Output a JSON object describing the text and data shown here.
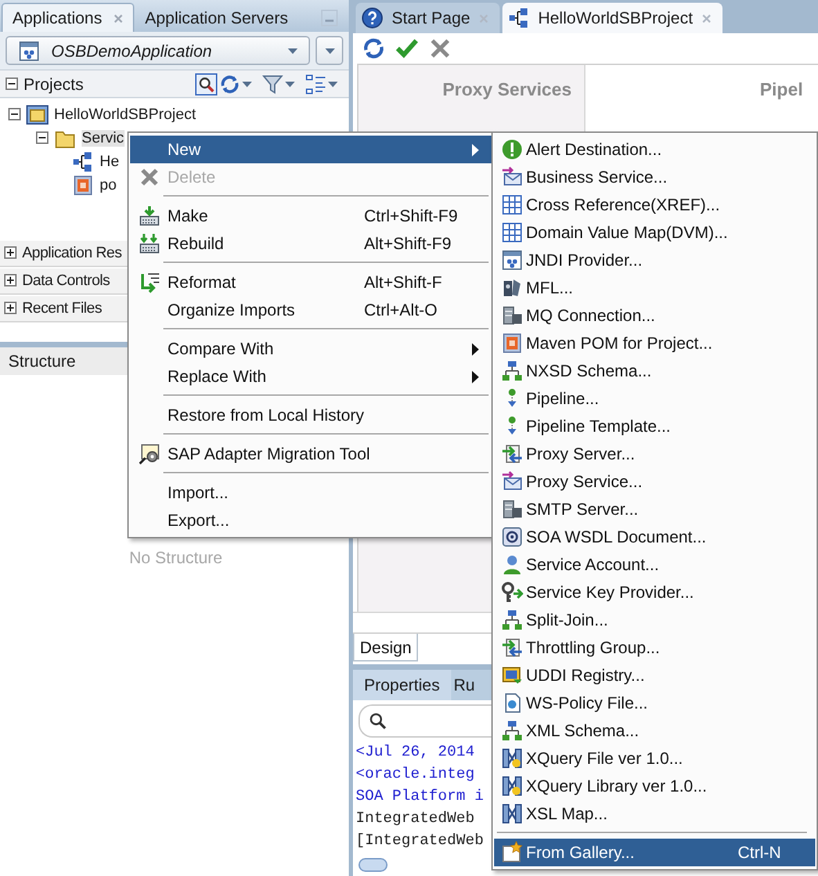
{
  "left_panel": {
    "tabs": [
      {
        "label": "Applications",
        "selected": true,
        "closable": true
      },
      {
        "label": "Application Servers",
        "selected": false,
        "closable": false
      }
    ],
    "application_selector": {
      "value": "OSBDemoApplication"
    },
    "projects_header": {
      "label": "Projects",
      "expanded": true
    },
    "project_tree": [
      {
        "label": "HelloWorldSBProject",
        "expanded": true,
        "selected": false,
        "children": [
          {
            "label": "Servic",
            "expanded": true,
            "selected": true,
            "children": [
              {
                "label": "He",
                "selected": false
              },
              {
                "label": "po",
                "selected": false
              }
            ]
          }
        ]
      }
    ],
    "accordion": [
      {
        "label": "Application Res",
        "expanded": false
      },
      {
        "label": "Data Controls",
        "expanded": false
      },
      {
        "label": "Recent Files",
        "expanded": false
      }
    ],
    "structure": {
      "title": "Structure",
      "empty_text": "No Structure"
    }
  },
  "editor": {
    "tabs": [
      {
        "label": "Start Page",
        "selected": false,
        "closable": true
      },
      {
        "label": "HelloWorldSBProject",
        "selected": true,
        "closable": true
      }
    ],
    "columns": [
      "Proxy Services",
      "Pipel"
    ],
    "view_tabs": [
      {
        "label": "Design",
        "selected": true
      }
    ]
  },
  "log_panel": {
    "tabs": [
      {
        "label": "Properties",
        "selected": true
      },
      {
        "label": "Ru",
        "selected": false
      }
    ],
    "lines": [
      {
        "text": "<Jul 26, 2014",
        "color": "#2020d0"
      },
      {
        "text": "<oracle.integ",
        "color": "#2020d0"
      },
      {
        "text": "SOA Platform i",
        "color": "#2020d0"
      },
      {
        "text": "IntegratedWeb",
        "color": "#202020"
      },
      {
        "text": "[IntegratedWeb",
        "color": "#202020"
      }
    ]
  },
  "context_menu": {
    "groups": [
      [
        {
          "label": "New",
          "selected": true,
          "disabled": false,
          "has_submenu": true
        },
        {
          "label": "Delete",
          "selected": false,
          "disabled": true,
          "has_submenu": false
        }
      ],
      [
        {
          "label": "Make",
          "shortcut": "Ctrl+Shift-F9",
          "selected": false,
          "disabled": false,
          "has_submenu": false
        },
        {
          "label": "Rebuild",
          "shortcut": "Alt+Shift-F9",
          "selected": false,
          "disabled": false,
          "has_submenu": false
        }
      ],
      [
        {
          "label": "Reformat",
          "shortcut": "Alt+Shift-F",
          "selected": false,
          "disabled": false,
          "has_submenu": false
        },
        {
          "label": "Organize Imports",
          "shortcut": "Ctrl+Alt-O",
          "selected": false,
          "disabled": false,
          "has_submenu": false
        }
      ],
      [
        {
          "label": "Compare With",
          "selected": false,
          "disabled": false,
          "has_submenu": true
        },
        {
          "label": "Replace With",
          "selected": false,
          "disabled": false,
          "has_submenu": true
        }
      ],
      [
        {
          "label": "Restore from Local History",
          "selected": false,
          "disabled": false,
          "has_submenu": false
        }
      ],
      [
        {
          "label": "SAP Adapter Migration Tool",
          "selected": false,
          "disabled": false,
          "has_submenu": false
        }
      ],
      [
        {
          "label": "Import...",
          "selected": false,
          "disabled": false,
          "has_submenu": false
        },
        {
          "label": "Export...",
          "selected": false,
          "disabled": false,
          "has_submenu": false
        }
      ]
    ]
  },
  "submenu": {
    "groups": [
      [
        {
          "label": "Alert Destination...",
          "selected": false,
          "disabled": false,
          "has_submenu": false
        },
        {
          "label": "Business Service...",
          "selected": false,
          "disabled": false,
          "has_submenu": false
        },
        {
          "label": "Cross Reference(XREF)...",
          "selected": false,
          "disabled": false,
          "has_submenu": false
        },
        {
          "label": "Domain Value Map(DVM)...",
          "selected": false,
          "disabled": false,
          "has_submenu": false
        },
        {
          "label": "JNDI Provider...",
          "selected": false,
          "disabled": false,
          "has_submenu": false
        },
        {
          "label": "MFL...",
          "selected": false,
          "disabled": false,
          "has_submenu": false
        },
        {
          "label": "MQ Connection...",
          "selected": false,
          "disabled": false,
          "has_submenu": false
        },
        {
          "label": "Maven POM for Project...",
          "selected": false,
          "disabled": false,
          "has_submenu": false
        },
        {
          "label": "NXSD Schema...",
          "selected": false,
          "disabled": false,
          "has_submenu": false
        },
        {
          "label": "Pipeline...",
          "selected": false,
          "disabled": false,
          "has_submenu": false
        },
        {
          "label": "Pipeline Template...",
          "selected": false,
          "disabled": false,
          "has_submenu": false
        },
        {
          "label": "Proxy Server...",
          "selected": false,
          "disabled": false,
          "has_submenu": false
        },
        {
          "label": "Proxy Service...",
          "selected": false,
          "disabled": false,
          "has_submenu": false
        },
        {
          "label": "SMTP Server...",
          "selected": false,
          "disabled": false,
          "has_submenu": false
        },
        {
          "label": "SOA WSDL Document...",
          "selected": false,
          "disabled": false,
          "has_submenu": false
        },
        {
          "label": "Service Account...",
          "selected": false,
          "disabled": false,
          "has_submenu": false
        },
        {
          "label": "Service Key Provider...",
          "selected": false,
          "disabled": false,
          "has_submenu": false
        },
        {
          "label": "Split-Join...",
          "selected": false,
          "disabled": false,
          "has_submenu": false
        },
        {
          "label": "Throttling Group...",
          "selected": false,
          "disabled": false,
          "has_submenu": false
        },
        {
          "label": "UDDI Registry...",
          "selected": false,
          "disabled": false,
          "has_submenu": false
        },
        {
          "label": "WS-Policy File...",
          "selected": false,
          "disabled": false,
          "has_submenu": false
        },
        {
          "label": "XML Schema...",
          "selected": false,
          "disabled": false,
          "has_submenu": false
        },
        {
          "label": "XQuery File ver 1.0...",
          "selected": false,
          "disabled": false,
          "has_submenu": false
        },
        {
          "label": "XQuery Library ver 1.0...",
          "selected": false,
          "disabled": false,
          "has_submenu": false
        },
        {
          "label": "XSL Map...",
          "selected": false,
          "disabled": false,
          "has_submenu": false
        }
      ],
      [
        {
          "label": "From Gallery...",
          "shortcut": "Ctrl-N",
          "selected": true,
          "disabled": false,
          "has_submenu": false
        }
      ]
    ]
  }
}
